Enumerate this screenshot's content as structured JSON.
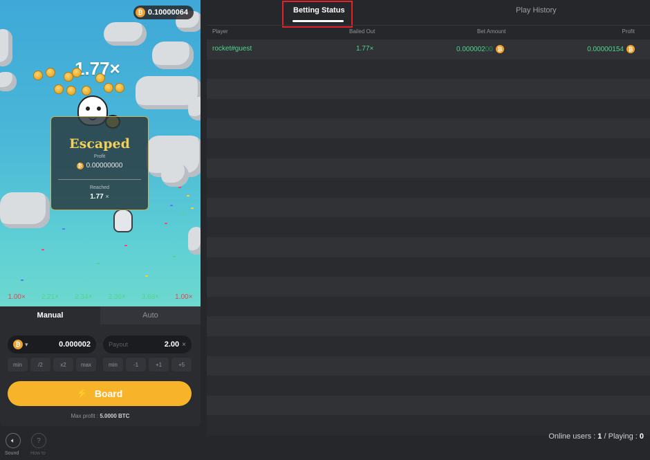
{
  "game": {
    "balance": "0.10000064",
    "current_multiplier": "1.77×",
    "escape_card": {
      "title": "Escaped",
      "profit_label": "Profit",
      "profit_value": "0.00000000",
      "reached_label": "Reached",
      "reached_value": "1.77",
      "reached_suffix": "×"
    },
    "history": [
      {
        "value": "1.00×",
        "color": "#e0474c"
      },
      {
        "value": "2.21×",
        "color": "#4fd68b"
      },
      {
        "value": "2.34×",
        "color": "#4fd68b"
      },
      {
        "value": "2.36×",
        "color": "#4fd68b"
      },
      {
        "value": "3.68×",
        "color": "#4fd68b"
      },
      {
        "value": "1.00×",
        "color": "#e0474c"
      }
    ]
  },
  "controls": {
    "tabs": [
      "Manual",
      "Auto"
    ],
    "active_tab": "Manual",
    "bet_amount": "0.000002",
    "payout_label": "Payout",
    "payout_value": "2.00",
    "payout_suffix": "×",
    "amount_buttons": [
      "min",
      "/2",
      "x2",
      "max"
    ],
    "payout_buttons": [
      "min",
      "-1",
      "+1",
      "+5"
    ],
    "board_label": "Board",
    "max_profit_label": "Max profit :",
    "max_profit_value": "5.0000 BTC",
    "sound_label": "Sound",
    "howto_label": "How to"
  },
  "right_panel": {
    "tabs": {
      "betting_status": "Betting Status",
      "play_history": "Play History"
    },
    "table": {
      "headers": {
        "player": "Player",
        "bailed_out": "Bailed Out",
        "bet_amount": "Bet Amount",
        "profit": "Profit"
      },
      "rows": [
        {
          "player": "rocket#guest",
          "bailed_out": "1.77×",
          "bet_main": "0.000002",
          "bet_dim": "00",
          "profit": "0.00000154"
        }
      ],
      "empty_rows": 19
    },
    "footer": {
      "online_label": "Online users :",
      "online_value": "1",
      "sep": "/",
      "playing_label": "Playing :",
      "playing_value": "0"
    }
  },
  "colors": {
    "accent": "#f7b42a",
    "win_green": "#4fd68b",
    "loss_red": "#e0474c",
    "highlight_red": "#e3222a"
  }
}
